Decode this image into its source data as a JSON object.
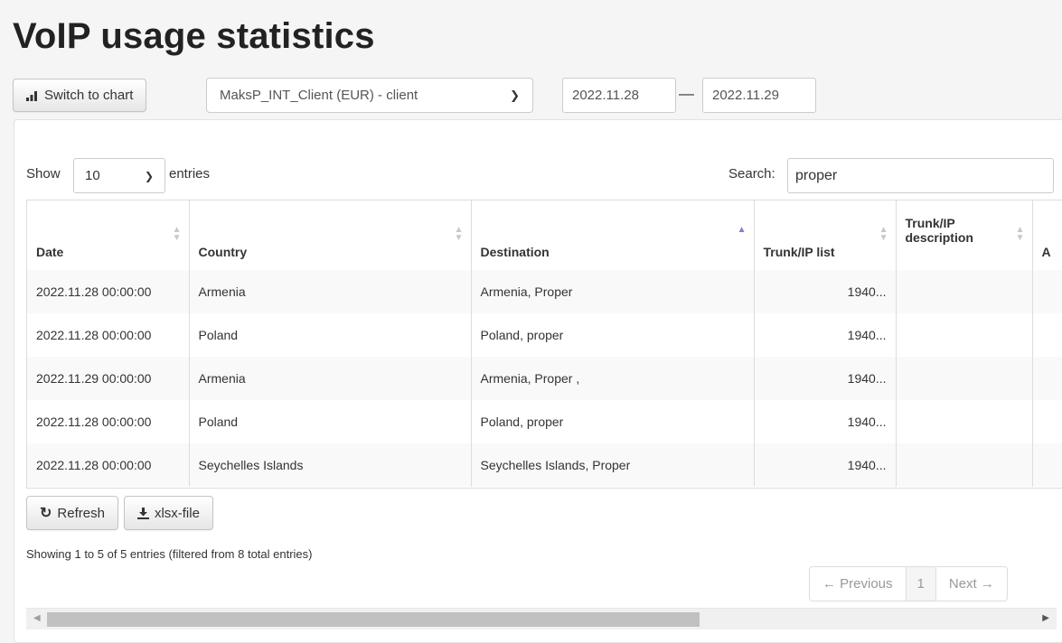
{
  "page_title": "VoIP usage statistics",
  "toolbar": {
    "switch_label": "Switch to chart",
    "client_select": "MaksP_INT_Client (EUR) - client",
    "date_from": "2022.11.28",
    "date_separator": "—",
    "date_to": "2022.11.29"
  },
  "table_controls": {
    "show_label": "Show",
    "page_length": "10",
    "entries_label": "entries",
    "search_label": "Search:",
    "search_value": "proper"
  },
  "columns": [
    "Date",
    "Country",
    "Destination",
    "Trunk/IP list",
    "Trunk/IP\ndescription",
    "A"
  ],
  "sorted_column": "Destination",
  "rows": [
    {
      "date": "2022.11.28 00:00:00",
      "country": "Armenia",
      "destination": "Armenia, Proper",
      "trunk": "1940..."
    },
    {
      "date": "2022.11.28 00:00:00",
      "country": "Poland",
      "destination": "Poland, proper",
      "trunk": "1940..."
    },
    {
      "date": "2022.11.29 00:00:00",
      "country": "Armenia",
      "destination": "Armenia, Proper ,",
      "trunk": "1940..."
    },
    {
      "date": "2022.11.28 00:00:00",
      "country": "Poland",
      "destination": "Poland, proper",
      "trunk": "1940..."
    },
    {
      "date": "2022.11.28 00:00:00",
      "country": "Seychelles Islands",
      "destination": "Seychelles Islands, Proper",
      "trunk": "1940..."
    }
  ],
  "actions": {
    "refresh_label": "Refresh",
    "xlsx_label": "xlsx-file"
  },
  "info_text": "Showing 1 to 5 of 5 entries (filtered from 8 total entries)",
  "pagination": {
    "previous": "← Previous",
    "current": "1",
    "next": "Next →"
  },
  "colors": {
    "sort_active": "#7b7fd6",
    "stripe": "#f9f9f9"
  }
}
